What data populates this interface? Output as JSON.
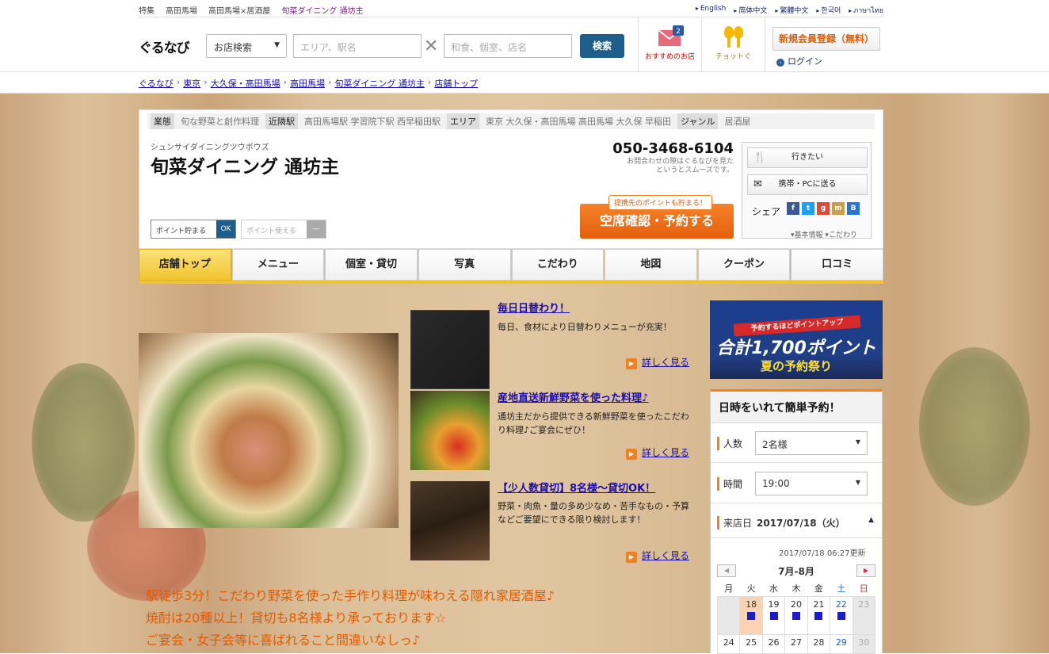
{
  "topbar": {
    "crumbs": [
      "特集",
      "高田馬場",
      "高田馬場×居酒屋",
      "旬菜ダイニング 通坊主"
    ],
    "langs": [
      "English",
      "简体中文",
      "繁體中文",
      "한국어",
      "ภาษาไทย"
    ]
  },
  "header": {
    "logo": "ぐるなび",
    "search_select": "お店検索",
    "area_placeholder": "エリア、駅名",
    "keyword_placeholder": "和食、個室、店名",
    "search_label": "検索",
    "rec_label": "おすすめのお店",
    "rec_count": "2",
    "choi_label": "チョットぐ",
    "register": "新規会員登録（無料）",
    "login": "ログイン"
  },
  "breadcrumb": [
    "ぐるなび",
    "東京",
    "大久保・高田馬場",
    "高田馬場",
    "旬菜ダイニング 通坊主",
    "店舗トップ"
  ],
  "shop": {
    "tags": [
      {
        "k": "業態",
        "v": "旬な野菜と創作料理"
      },
      {
        "k": "近隣駅",
        "v": "高田馬場駅 学習院下駅 西早稲田駅"
      },
      {
        "k": "エリア",
        "v": "東京 大久保・高田馬場 高田馬場 大久保 早稲田"
      },
      {
        "k": "ジャンル",
        "v": "居酒屋"
      }
    ],
    "kana": "シュンサイダイニングツウボウズ",
    "name": "旬菜ダイニング 通坊主",
    "phone": "050-3468-6104",
    "phone_note1": "お問合わせの際はぐるなびを見た",
    "phone_note2": "というとスムーズです。",
    "point_save": "ポイント貯まる",
    "point_use": "ポイント使える",
    "ok": "OK",
    "dash": "―",
    "point_note": "提携先のポイントも貯まる！",
    "reserve": "空席確認・予約する",
    "want": "行きたい",
    "send": "携帯・PCに送る",
    "share": "シェア",
    "info_link": "基本情報",
    "kodawari_link": "こだわり"
  },
  "nav": [
    "店舗トップ",
    "メニュー",
    "個室・貸切",
    "写真",
    "こだわり",
    "地図",
    "クーポン",
    "口コミ"
  ],
  "features": [
    {
      "title": "毎日日替わり！",
      "desc": "毎日、食材により日替わりメニューが充実！",
      "more": "詳しく見る"
    },
    {
      "title": "産地直送新鮮野菜を使った料理♪",
      "desc": "通坊主だから提供できる新鮮野菜を使ったこだわり料理♪ご宴会にぜひ！",
      "more": "詳しく見る"
    },
    {
      "title": "【少人数貸切】8名様～貸切OK！",
      "desc": "野菜・肉魚・量の多め少なめ・苦手なもの・予算などご要望にできる限り検討します！",
      "more": "詳しく見る"
    }
  ],
  "catch": [
    "駅徒歩3分！こだわり野菜を使った手作り料理が味わえる隠れ家居酒屋♪",
    "焼酎は20種以上！貸切も8名様より承っております☆",
    "ご宴会・女子会等に喜ばれること間違いなしっ♪"
  ],
  "promo": {
    "line1": "予約するほどポイントアップ",
    "line2": "合計1,700ポイント",
    "line3": "夏の予約祭り"
  },
  "reserve_box": {
    "title": "日時をいれて簡単予約！",
    "people_label": "人数",
    "people": "2名様",
    "time_label": "時間",
    "time": "19:00",
    "date_label": "来店日",
    "date": "2017/07/18（火）",
    "updated": "2017/07/18 06:27更新",
    "month": "7月-8月",
    "prev": "◀",
    "next": "▶",
    "weekdays": [
      "月",
      "火",
      "水",
      "木",
      "金",
      "土",
      "日"
    ],
    "week1": [
      "",
      "18",
      "19",
      "20",
      "21",
      "22",
      "23"
    ],
    "week2": [
      "24",
      "25",
      "26",
      "27",
      "28",
      "29",
      "30"
    ]
  }
}
